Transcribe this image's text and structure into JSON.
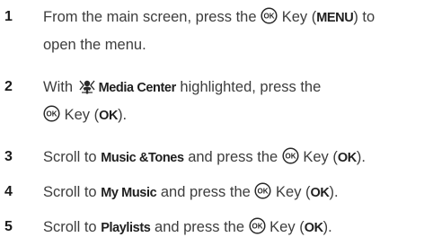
{
  "steps": [
    {
      "num": "1",
      "line1": {
        "a": "From the main screen, press the ",
        "b": " Key (",
        "bold1": "MENU",
        "c": ") to"
      },
      "line2": "open the menu."
    },
    {
      "num": "2",
      "line1": {
        "a": "With ",
        "bold1": "Media Center",
        "b": " highlighted, press the"
      },
      "line2": {
        "a": " Key (",
        "bold1": "OK",
        "b": ")."
      }
    },
    {
      "num": "3",
      "line1": {
        "a": "Scroll to ",
        "bold1": "Music &Tones",
        "b": " and press the ",
        "c": " Key (",
        "bold2": "OK",
        "d": ")."
      }
    },
    {
      "num": "4",
      "line1": {
        "a": "Scroll to ",
        "bold1": "My Music",
        "b": " and press the ",
        "c": " Key (",
        "bold2": "OK",
        "d": ")."
      }
    },
    {
      "num": "5",
      "line1": {
        "a": "Scroll to ",
        "bold1": "Playlists",
        "b": " and press the ",
        "c": " Key (",
        "bold2": "OK",
        "d": ")."
      }
    }
  ],
  "icons": {
    "ok_key": "ok-key-icon",
    "media_center": "media-center-icon"
  }
}
